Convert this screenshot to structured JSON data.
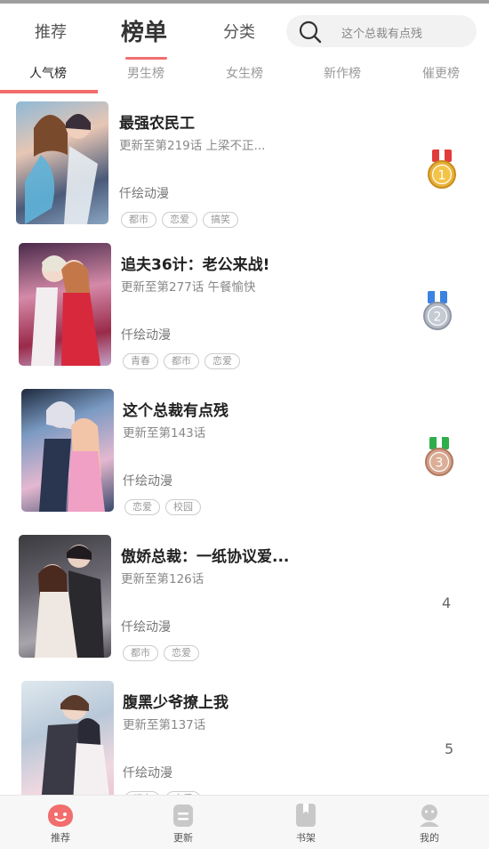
{
  "header": {
    "tabs": [
      {
        "label": "推荐"
      },
      {
        "label": "榜单"
      },
      {
        "label": "分类"
      }
    ],
    "search": {
      "placeholder": "这个总裁有点残",
      "icon": "search-icon"
    }
  },
  "rank_tabs": [
    {
      "label": "人气榜"
    },
    {
      "label": "男生榜"
    },
    {
      "label": "女生榜"
    },
    {
      "label": "新作榜"
    },
    {
      "label": "催更榜"
    }
  ],
  "items": [
    {
      "rank": "1",
      "title": "最强农民工",
      "update": "更新至第219话 上梁不正...",
      "author": "仟绘动漫",
      "tags": [
        "都市",
        "恋爱",
        "搞笑"
      ],
      "medal_color": "#e8b23a",
      "ribbon_color": "#e23b3b"
    },
    {
      "rank": "2",
      "title": "追夫36计：老公来战!",
      "update": "更新至第277话 午餐愉快",
      "author": "仟绘动漫",
      "tags": [
        "青春",
        "都市",
        "恋爱"
      ],
      "medal_color": "#b4bcc6",
      "ribbon_color": "#3b82e2"
    },
    {
      "rank": "3",
      "title": "这个总裁有点残",
      "update": "更新至第143话",
      "author": "仟绘动漫",
      "tags": [
        "恋爱",
        "校园"
      ],
      "medal_color": "#d4a088",
      "ribbon_color": "#2fae4a"
    },
    {
      "rank": "4",
      "title": "傲娇总裁：一纸协议爱...",
      "update": "更新至第126话",
      "author": "仟绘动漫",
      "tags": [
        "都市",
        "恋爱"
      ]
    },
    {
      "rank": "5",
      "title": "腹黑少爷撩上我",
      "update": "更新至第137话",
      "author": "仟绘动漫",
      "tags": [
        "都市",
        "恋爱"
      ]
    }
  ],
  "bottom_nav": [
    {
      "label": "推荐",
      "icon": "smile-face-icon"
    },
    {
      "label": "更新",
      "icon": "update-icon"
    },
    {
      "label": "书架",
      "icon": "bookshelf-icon"
    },
    {
      "label": "我的",
      "icon": "profile-icon"
    }
  ],
  "colors": {
    "accent": "#f26d6d"
  }
}
